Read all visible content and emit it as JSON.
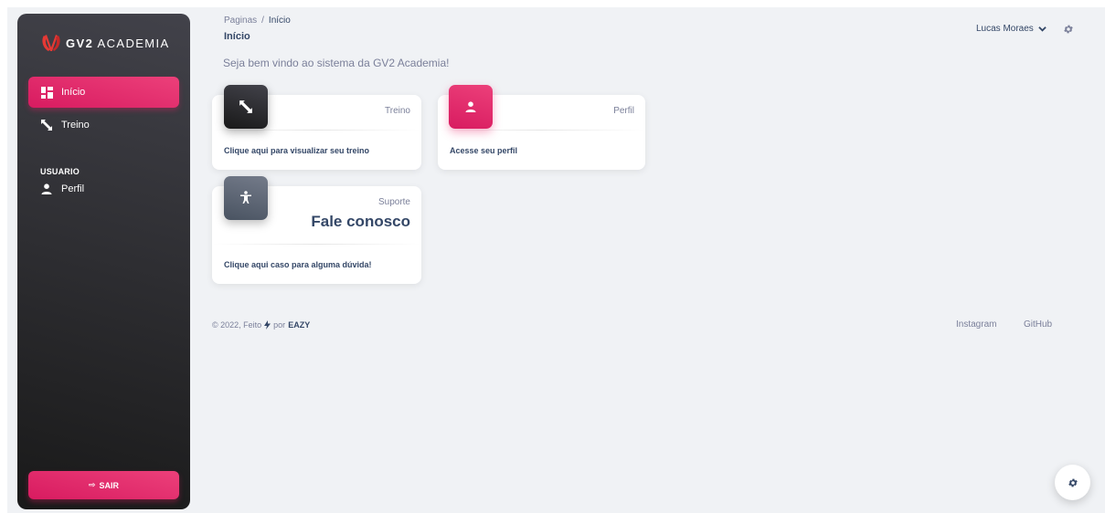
{
  "brand": {
    "name_bold": "GV2",
    "name_rest": "ACADEMIA"
  },
  "sidebar": {
    "items": [
      {
        "label": "Início",
        "icon": "dashboard-icon",
        "active": true
      },
      {
        "label": "Treino",
        "icon": "expand-arrows-icon",
        "active": false
      }
    ],
    "section_label": "USUARIO",
    "user_items": [
      {
        "label": "Perfil",
        "icon": "person-icon"
      }
    ],
    "logout_label": "SAIR"
  },
  "header": {
    "breadcrumb": {
      "parent": "Paginas",
      "separator": "/",
      "current": "Início"
    },
    "title": "Início",
    "user_name": "Lucas Moraes"
  },
  "welcome": "Seja bem vindo ao sistema da GV2 Academia!",
  "cards": [
    {
      "category": "Treino",
      "link": "Clique aqui para visualizar seu treino",
      "icon": "expand-arrows-icon"
    },
    {
      "category": "Perfil",
      "link": "Acesse seu perfil",
      "icon": "person-icon"
    },
    {
      "category": "Suporte",
      "title": "Fale conosco",
      "link": "Clique aqui caso para alguma dúvida!",
      "icon": "accessibility-icon"
    }
  ],
  "footer": {
    "copyright_prefix": "© 2022, Feito",
    "copyright_by": "por",
    "copyright_brand": "EAZY",
    "links": [
      "Instagram",
      "GitHub"
    ]
  },
  "colors": {
    "accent": "#e91e63",
    "sidebar_dark": "#191919",
    "text_primary": "#344767",
    "text_secondary": "#7b809a"
  }
}
